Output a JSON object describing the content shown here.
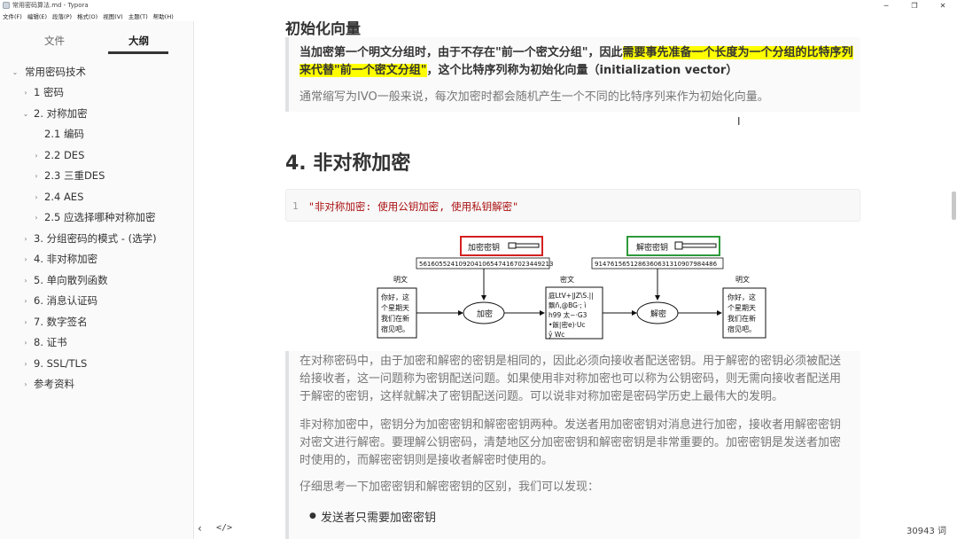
{
  "window": {
    "title": "常用密码算法.md - Typora",
    "controls": [
      "─",
      "❐",
      "✕"
    ]
  },
  "menu": [
    "文件(F)",
    "编辑(E)",
    "段落(P)",
    "格式(O)",
    "视图(V)",
    "主题(T)",
    "帮助(H)"
  ],
  "sidebar": {
    "tabs": {
      "files": "文件",
      "outline": "大纲"
    },
    "outline": [
      {
        "label": "常用密码技术",
        "level": 0,
        "arrow": "⌄"
      },
      {
        "label": "1 密码",
        "level": 1,
        "arrow": "›"
      },
      {
        "label": "2. 对称加密",
        "level": 1,
        "arrow": "⌄"
      },
      {
        "label": "2.1 编码",
        "level": 2,
        "arrow": ""
      },
      {
        "label": "2.2 DES",
        "level": 2,
        "arrow": "›"
      },
      {
        "label": "2.3 三重DES",
        "level": 2,
        "arrow": "›"
      },
      {
        "label": "2.4 AES",
        "level": 2,
        "arrow": "›"
      },
      {
        "label": "2.5 应选择哪种对称加密",
        "level": 2,
        "arrow": "›"
      },
      {
        "label": "3. 分组密码的模式 - (选学)",
        "level": 1,
        "arrow": "›"
      },
      {
        "label": "4. 非对称加密",
        "level": 1,
        "arrow": "›"
      },
      {
        "label": "5. 单向散列函数",
        "level": 1,
        "arrow": "›"
      },
      {
        "label": "6. 消息认证码",
        "level": 1,
        "arrow": "›"
      },
      {
        "label": "7. 数字签名",
        "level": 1,
        "arrow": "›"
      },
      {
        "label": "8. 证书",
        "level": 1,
        "arrow": "›"
      },
      {
        "label": "9. SSL/TLS",
        "level": 1,
        "arrow": "›"
      },
      {
        "label": "参考资料",
        "level": 1,
        "arrow": "›"
      }
    ]
  },
  "doc": {
    "partial_heading": "初始化向量",
    "q1_a": "当加密第一个明文分组时，由于不存在\"前一个密文分组\"，因此",
    "q1_mark_1": "需要事先准备一个长度为一个分组的比特序",
    "q1_mark_2": "列来代替\"前一个密文分组\"",
    "q1_b": "，这个比特序列称为初始化向量（initialization vector）",
    "q1_p2": "通常缩写为IVO一般来说，每次加密时都会随机产生一个不同的比特序列来作为初始化向量。",
    "h2": "4. 非对称加密",
    "code_line": "1",
    "code_text": "\"非对称加密: 使用公钥加密, 使用私钥解密\"",
    "bq2_lines": [
      "在对称密码中，由于加密和解密的密钥是相同的，因此必须向接收者配送密钥。用于解密的密钥必须被配送",
      "给接收者，这一问题称为密钥配送问题。如果使用非对称加密也可以称为公钥密码，则无需向接收者配送用",
      "于解密的密钥，这样就解决了密钥配送问题。可以说非对称加密是密码学历史上最伟大的发明。"
    ],
    "bq2_p2_lines": [
      "非对称加密中，密钥分为加密密钥和解密密钥两种。发送者用加密密钥对消息进行加密，接收者用解密密钥",
      "对密文进行解密。要理解公钥密码，清楚地区分加密密钥和解密密钥是非常重要的。加密密钥是发送者加密",
      "时使用的，而解密密钥则是接收者解密时使用的。"
    ],
    "bq2_p3": "仔细思考一下加密密钥和解密密钥的区别，我们可以发现：",
    "list_item": "发送者只需要加密密钥"
  },
  "diagram": {
    "enc_key_label": "加密密钥",
    "dec_key_label": "解密密钥",
    "enc_key_value": "5616055241092041065474167023449213",
    "dec_key_value": "9147615651286360631310907984486",
    "plaintext_label": "明文",
    "ciphertext_label": "密文",
    "plaintext_lines": [
      "你好，这",
      "个星期天",
      "我们在新",
      "宿见吧。"
    ],
    "cipher_lines": [
      "庭LtV+|JZ\\S.||",
      "飘ñ,@BG·; ì",
      "h99 太∽·G3",
      "•飯|密e)·Uc",
      "ŷ Wc"
    ],
    "encrypt_label": "加密",
    "decrypt_label": "解密",
    "colors": {
      "enc_border": "#d32020",
      "dec_border": "#2e9a3a"
    }
  },
  "status": {
    "back": "‹",
    "source": "</>",
    "word_count": "30943 词"
  }
}
